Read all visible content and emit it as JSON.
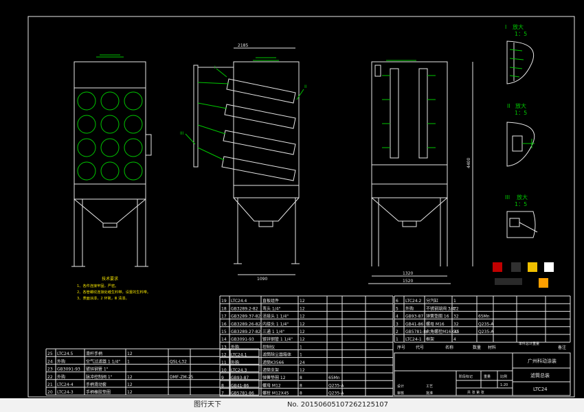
{
  "detail_views": [
    {
      "numeral": "I",
      "title": "放大",
      "scale": "1：5"
    },
    {
      "numeral": "II",
      "title": "放大",
      "scale": "1：5"
    },
    {
      "numeral": "III",
      "title": "放大",
      "scale": "1：5"
    }
  ],
  "callouts": {
    "c1": "I",
    "c2": "II",
    "c3": "III"
  },
  "dimensions": {
    "top": "2185",
    "bottom_mid": "1090",
    "right_a": "1320",
    "right_b": "1520",
    "height": "4400"
  },
  "tech_notes": {
    "title": "技术要求",
    "lines": [
      "1、各件连接牢固，严密。",
      "2、各管螺纹连接处缠生料带，设置的生料带。",
      "3、表面涂漆，2 环氧，Ⅲ 清漆。"
    ]
  },
  "bom_left": [
    [
      "25",
      "LTC24.5",
      "滑杆手柄",
      "12"
    ],
    [
      "24",
      "外购",
      "空气过滤器 1 1/4\"",
      "1",
      "QSL-L32"
    ],
    [
      "23",
      "GB3091-93",
      "镀锌钢管 1\"",
      ""
    ],
    [
      "22",
      "外购",
      "脉冲控制阀 1\"",
      "12",
      "DMF-ZM-25"
    ],
    [
      "21",
      "LTC24-4",
      "手柄滑动套",
      "12"
    ],
    [
      "20",
      "LTC24-3",
      "手柄橡胶垫圈",
      "12"
    ]
  ],
  "bom_mid": [
    [
      "19",
      "LTC24.4",
      "直板组件",
      "12"
    ],
    [
      "18",
      "GB3289.2-82",
      "弯头 1/4\"",
      "12"
    ],
    [
      "17",
      "GB3289.37-82",
      "活接头 1 1/4\"",
      "12"
    ],
    [
      "16",
      "GB3289.26-82",
      "内接头 1 1/4\"",
      "12"
    ],
    [
      "15",
      "GB3289.27-82",
      "三通 1 1/4\"",
      "12"
    ],
    [
      "14",
      "GB3091-93",
      "镀锌钢管 1 1/4\"",
      "12"
    ],
    [
      "13",
      "外购",
      "控制仪",
      "1"
    ],
    [
      "12",
      "LTC24.1",
      "滤筒除尘器箱体",
      "1"
    ],
    [
      "11",
      "外购",
      "滤筒K3566",
      "24"
    ],
    [
      "10",
      "LTC24.3",
      "滤筒支架",
      "12"
    ],
    [
      "9",
      "GB93-87",
      "弹簧垫圈 12",
      "8",
      "65Mn"
    ],
    [
      "8",
      "GB41-86",
      "螺母 M12",
      "8",
      "Q235-A"
    ],
    [
      "7",
      "GB5781-86",
      "螺栓 M12X45",
      "8",
      "Q235-A"
    ]
  ],
  "bom_right": [
    [
      "6",
      "LTC24.2",
      "分汽缸",
      "1"
    ],
    [
      "5",
      "外购",
      "不锈钢球阀 3/4\"",
      "12"
    ],
    [
      "4",
      "GB93-87",
      "弹簧垫圈 16",
      "32",
      "65Mn"
    ],
    [
      "3",
      "GB41-86",
      "螺母 M16",
      "32",
      "Q235-A"
    ],
    [
      "2",
      "GB5781-86",
      "六角螺栓M16X45",
      "32",
      "Q235-A"
    ],
    [
      "1",
      "LTC24-1",
      "框架",
      "4"
    ]
  ],
  "bom_header": {
    "seq": "序号",
    "code": "代号",
    "name": "名称",
    "qty": "数量",
    "material": "材料",
    "weight": "单件总计重量",
    "note": "备注"
  },
  "title_block": {
    "company": "广州科动涂装",
    "drawing_name": "滤筒总装",
    "drawing_no": "LTC24",
    "stage_label": "阶段标记",
    "weight_label": "重量",
    "scale_label": "比例",
    "scale_value": "1:20",
    "sheet_label": "共 张 第 张",
    "designer": "设计",
    "reviewer": "审核",
    "process": "工艺",
    "approve": "批准"
  },
  "colors": {
    "line": "#e8e8e8",
    "accent": "#00c800",
    "notes": "#f0e000",
    "swatches": [
      "#c00000",
      "#303030",
      "#f0c000",
      "#ffffff",
      "#202020",
      "#ffa000"
    ]
  },
  "footer": {
    "logo": "图行天下",
    "id": "No. 20150605107262125107"
  }
}
